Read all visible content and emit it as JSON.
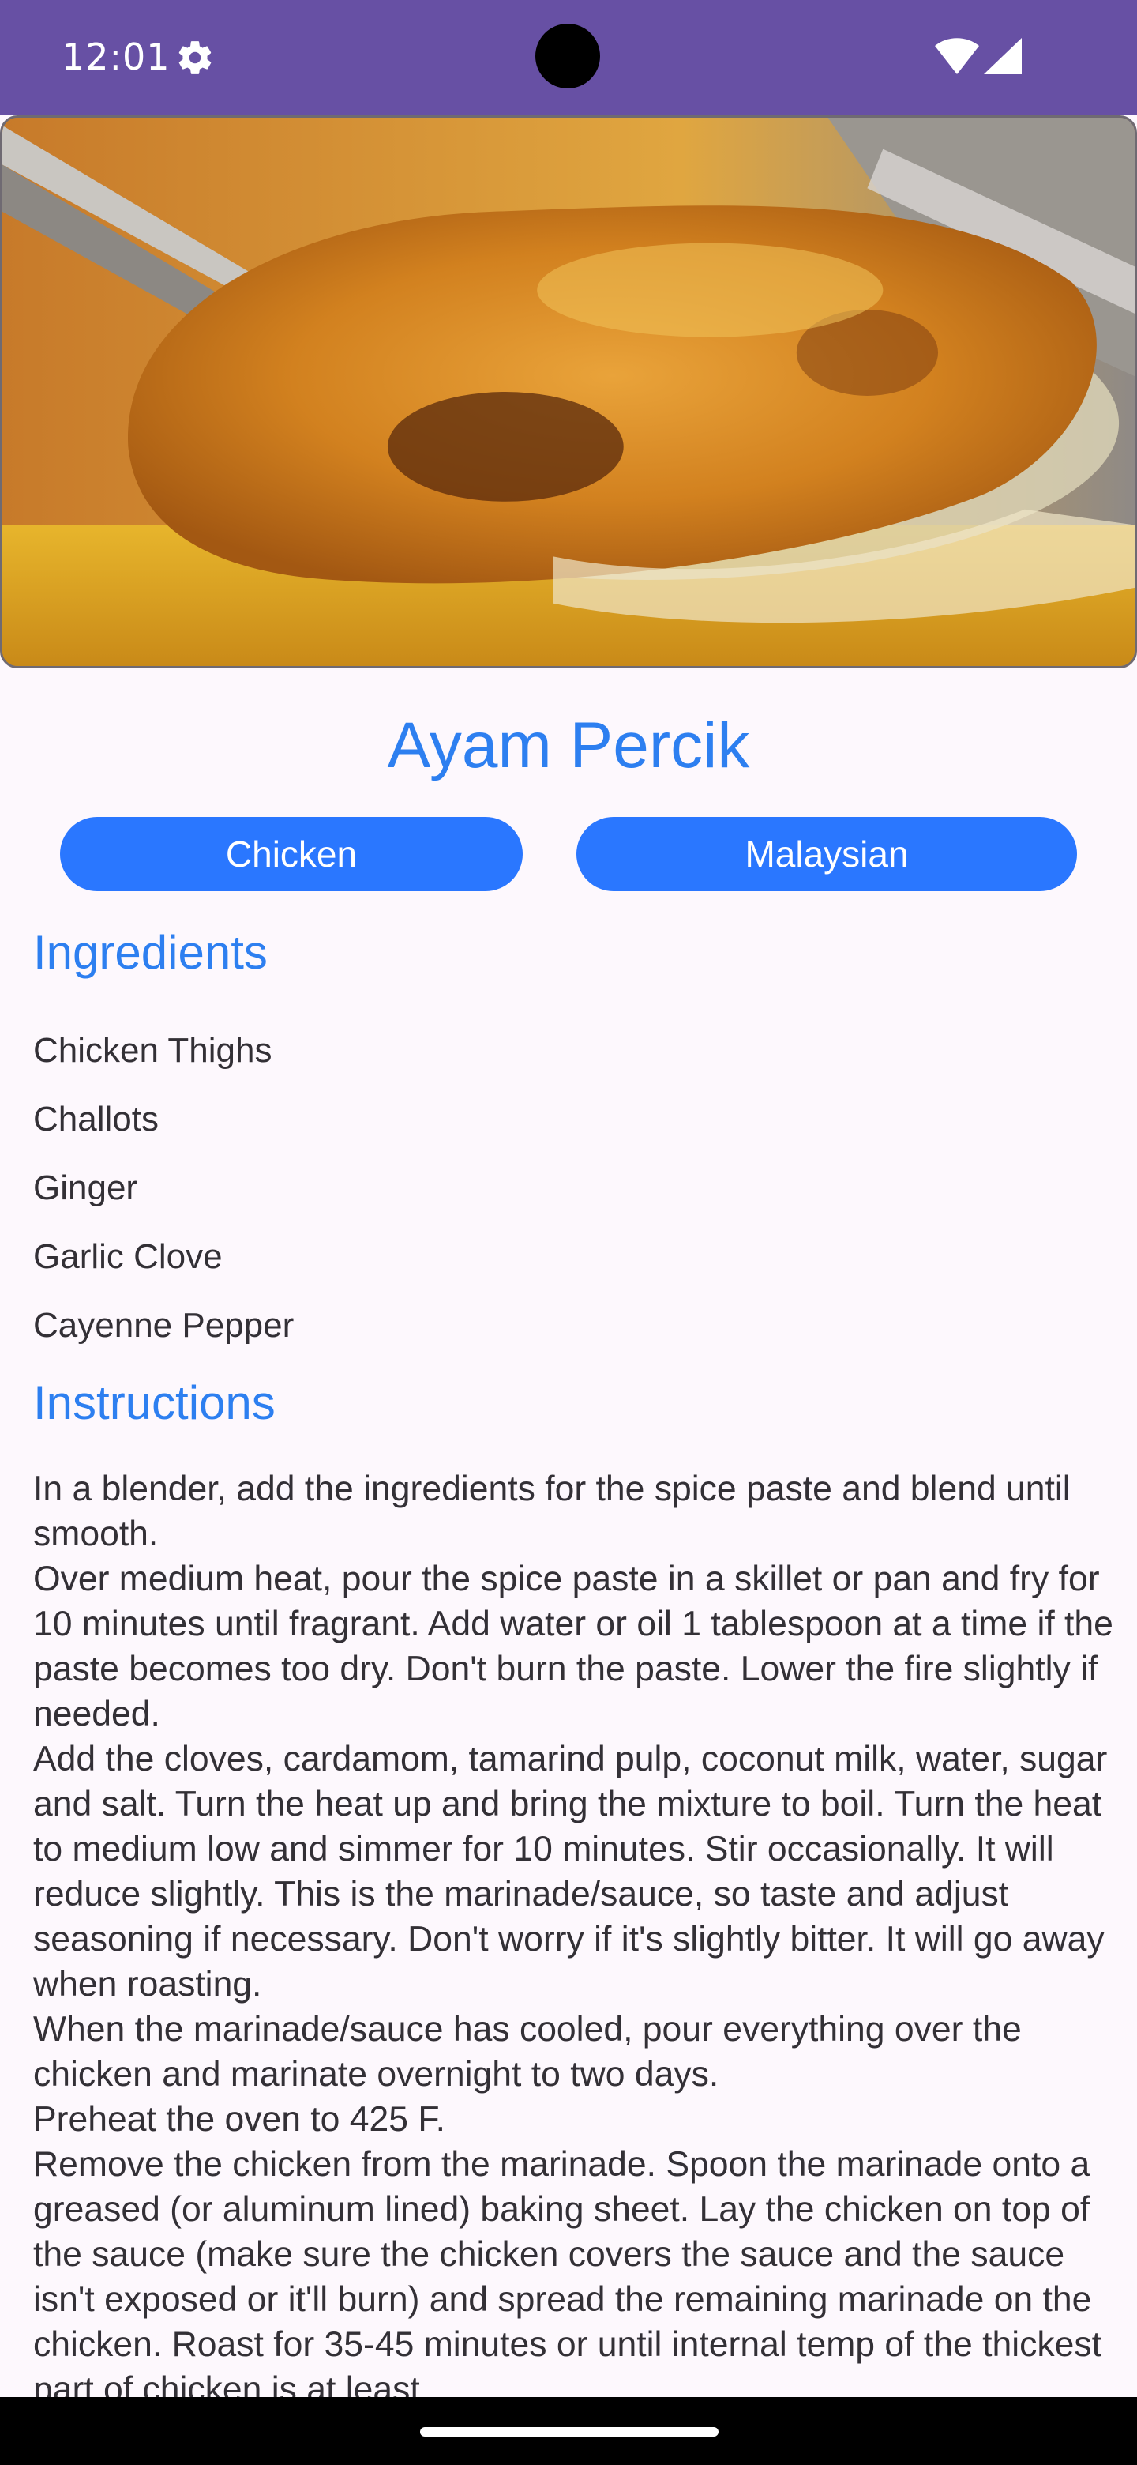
{
  "status_bar": {
    "time": "12:01",
    "background_color": "#6750a4",
    "icons": [
      "gear-icon",
      "wifi-icon",
      "signal-icon"
    ]
  },
  "recipe": {
    "title": "Ayam Percik",
    "category": "Chicken",
    "area": "Malaysian",
    "ingredients_heading": "Ingredients",
    "ingredients": [
      "Chicken Thighs",
      "Challots",
      "Ginger",
      "Garlic Clove",
      "Cayenne Pepper"
    ],
    "instructions_heading": "Instructions",
    "instructions": "In a blender, add the ingredients for the spice paste and blend until smooth.\nOver medium heat, pour the spice paste in a skillet or pan and fry for 10 minutes until fragrant. Add water or oil 1 tablespoon at a time if the paste becomes too dry. Don't burn the paste. Lower the fire slightly if needed.\nAdd the cloves, cardamom, tamarind pulp, coconut milk, water, sugar and salt. Turn the heat up and bring the mixture to boil. Turn the heat to medium low and simmer for 10 minutes. Stir occasionally. It will reduce slightly. This is the marinade/sauce, so taste and adjust seasoning if necessary. Don't worry if it's slightly bitter. It will go away when roasting.\nWhen the marinade/sauce has cooled, pour everything over the chicken and marinate overnight to two days.\nPreheat the oven to 425 F.\nRemove the chicken from the marinade. Spoon the marinade onto a greased (or aluminum lined) baking sheet. Lay the chicken on top of the sauce (make sure the chicken covers the sauce and the sauce isn't exposed or it'll burn) and spread the remaining marinade on the chicken. Roast for 35-45 minutes or until internal temp of the thickest part of chicken is at least"
  },
  "colors": {
    "accent_text": "#2d7ff0",
    "chip_background": "#2a77ff",
    "body_text": "#333036",
    "page_background": "#fdf8fd"
  }
}
